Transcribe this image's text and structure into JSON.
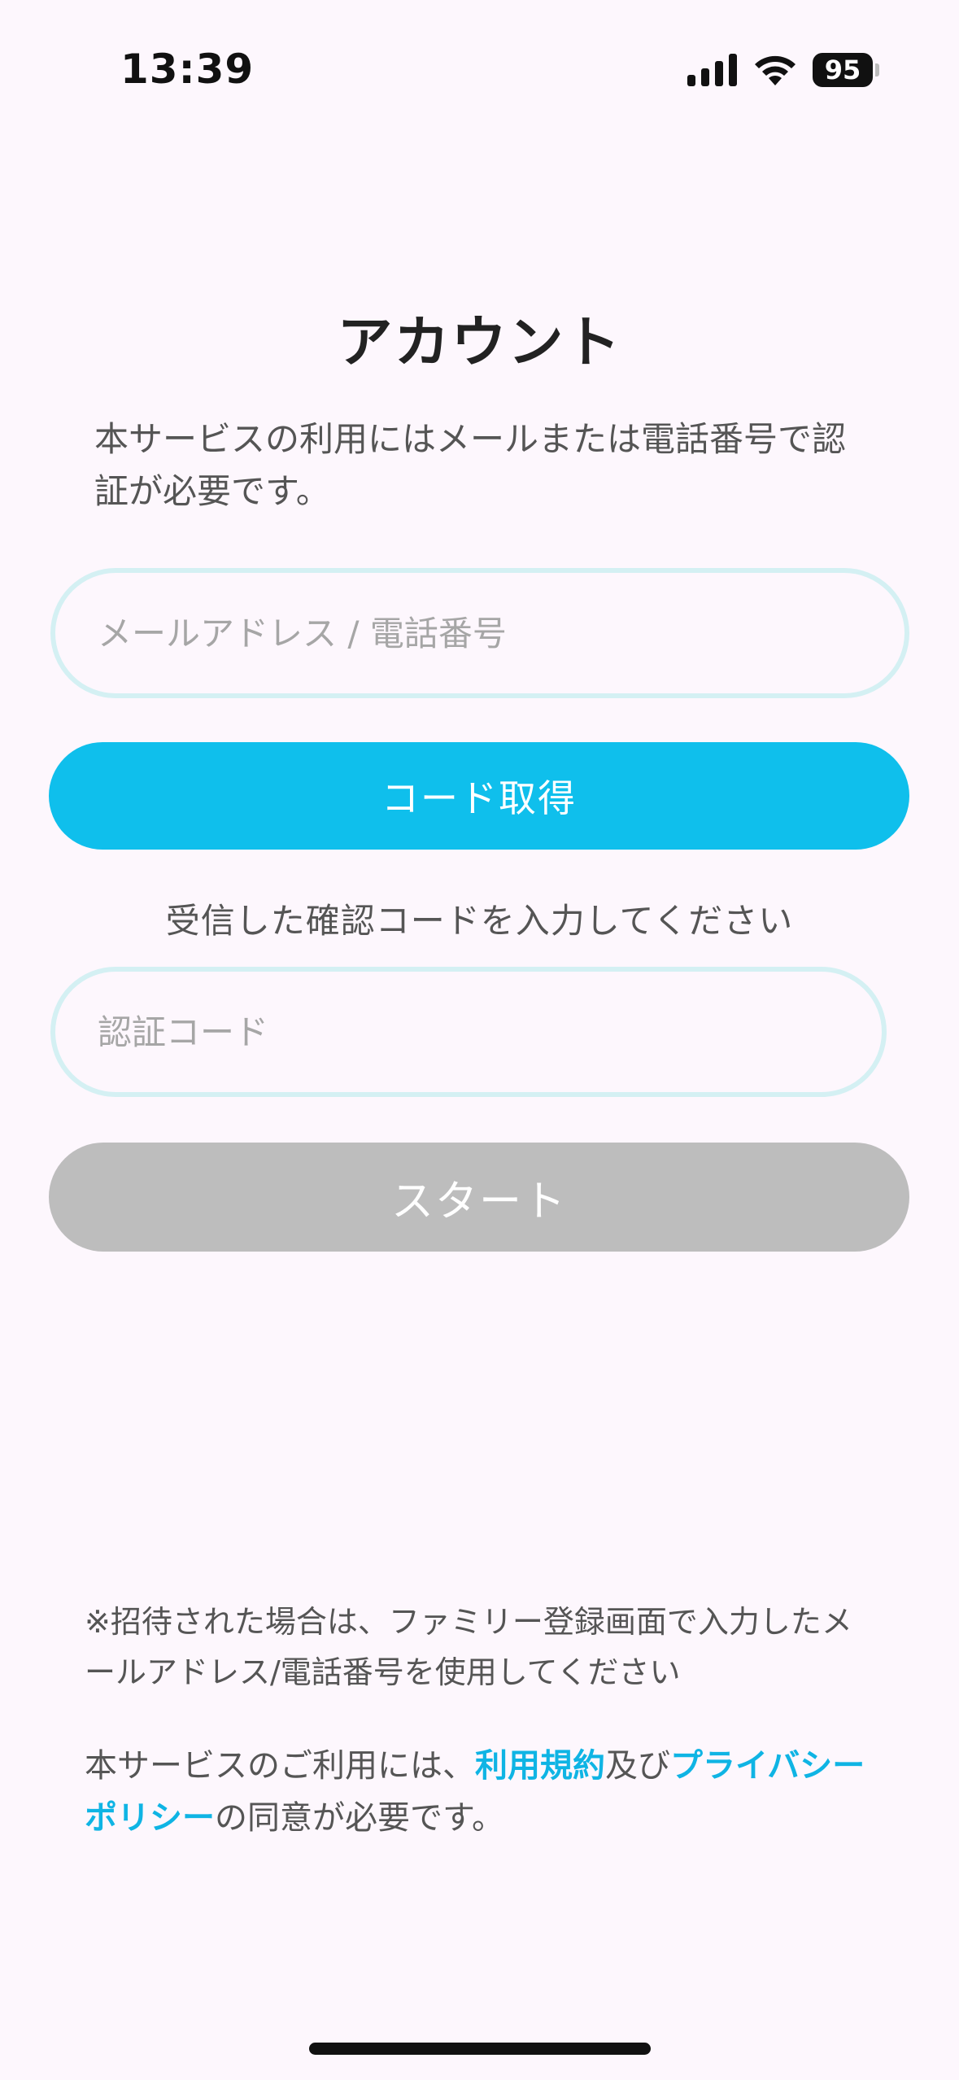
{
  "status_bar": {
    "time": "13:39",
    "battery_level": "95",
    "icons": [
      "signal-icon",
      "wifi-icon",
      "battery-icon"
    ]
  },
  "title": "アカウント",
  "intro": "本サービスの利用にはメールまたは電話番号で認証が必要です。",
  "email_input": {
    "placeholder": "メールアドレス / 電話番号",
    "value": ""
  },
  "get_code_button": {
    "label": "コード取得",
    "color": "#0fbfec"
  },
  "code_instruction": "受信した確認コードを入力してください",
  "code_input": {
    "placeholder": "認証コード",
    "value": ""
  },
  "start_button": {
    "label": "スタート",
    "color": "#bdbdbd",
    "state": "disabled"
  },
  "invite_note": "※招待された場合は、ファミリー登録画面で入力したメールアドレス/電話番号を使用してください",
  "consent": {
    "prefix": "本サービスのご利用には、",
    "terms_link": "利用規約",
    "connector": "及び",
    "privacy_link": "プライバシーポリシー",
    "suffix": "の同意が必要です。",
    "link_color": "#0fb4e4"
  }
}
